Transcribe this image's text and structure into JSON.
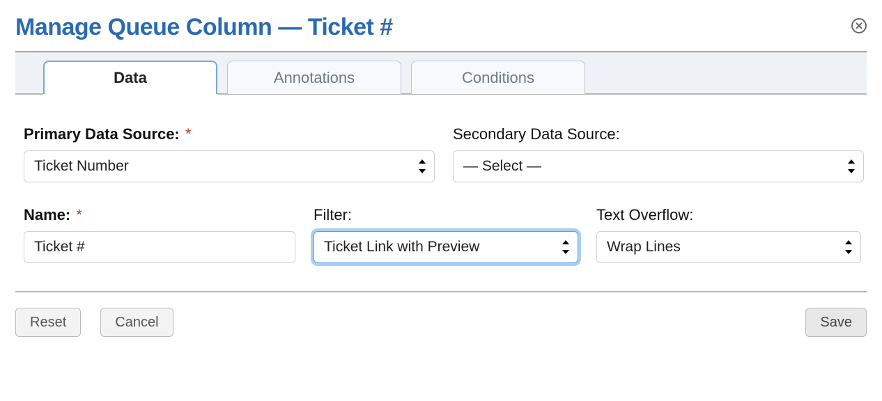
{
  "title": "Manage Queue Column — Ticket #",
  "tabs": [
    {
      "label": "Data",
      "active": true
    },
    {
      "label": "Annotations",
      "active": false
    },
    {
      "label": "Conditions",
      "active": false
    }
  ],
  "fields": {
    "primary_source": {
      "label": "Primary Data Source:",
      "required": true,
      "value": "Ticket Number"
    },
    "secondary_source": {
      "label": "Secondary Data Source:",
      "required": false,
      "value": "— Select —"
    },
    "name": {
      "label": "Name:",
      "required": true,
      "value": "Ticket #"
    },
    "filter": {
      "label": "Filter:",
      "required": false,
      "value": "Ticket Link with Preview"
    },
    "text_overflow": {
      "label": "Text Overflow:",
      "required": false,
      "value": "Wrap Lines"
    }
  },
  "required_marker": "*",
  "buttons": {
    "reset": "Reset",
    "cancel": "Cancel",
    "save": "Save"
  }
}
